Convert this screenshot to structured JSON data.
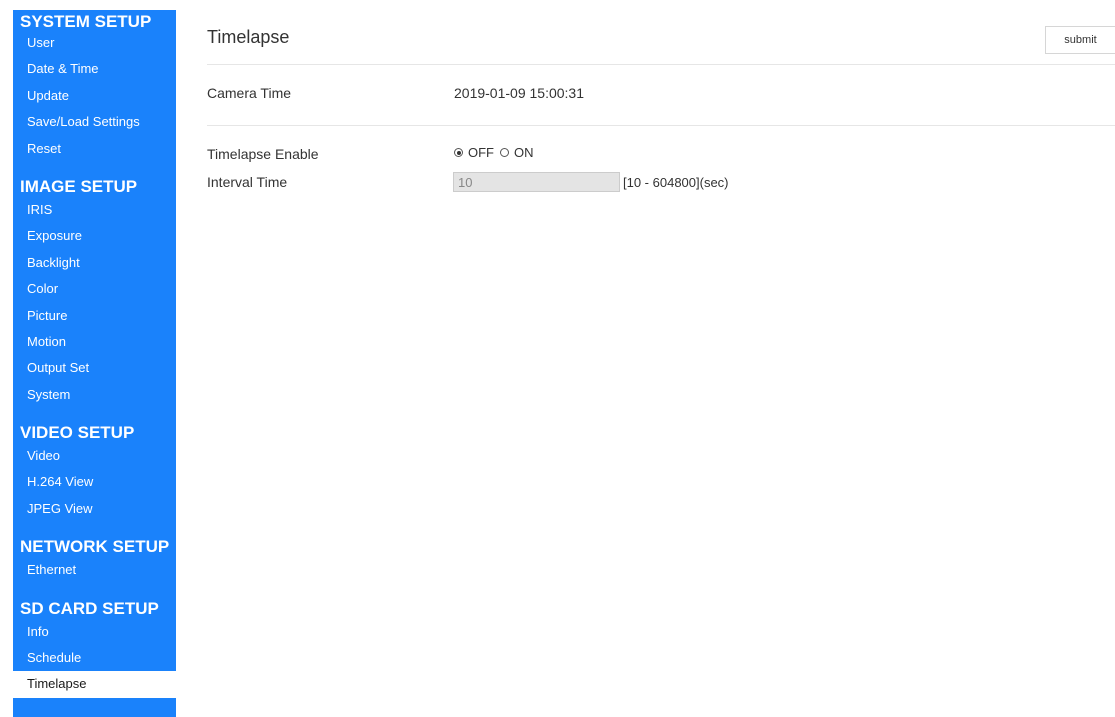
{
  "sidebar": {
    "sections": [
      {
        "title": "SYSTEM SETUP",
        "items": [
          "User",
          "Date & Time",
          "Update",
          "Save/Load Settings",
          "Reset"
        ]
      },
      {
        "title": "IMAGE SETUP",
        "items": [
          "IRIS",
          "Exposure",
          "Backlight",
          "Color",
          "Picture",
          "Motion",
          "Output Set",
          "System"
        ]
      },
      {
        "title": "VIDEO SETUP",
        "items": [
          "Video",
          "H.264 View",
          "JPEG View"
        ]
      },
      {
        "title": "NETWORK SETUP",
        "items": [
          "Ethernet"
        ]
      },
      {
        "title": "SD CARD SETUP",
        "items": [
          "Info",
          "Schedule",
          "Timelapse"
        ]
      }
    ],
    "active_item": "Timelapse",
    "background_color": "#1a82fb"
  },
  "main": {
    "title": "Timelapse",
    "submit_label": "submit",
    "camera_time": {
      "label": "Camera Time",
      "value": "2019-01-09 15:00:31"
    },
    "timelapse_enable": {
      "label": "Timelapse Enable",
      "options": [
        "OFF",
        "ON"
      ],
      "selected": "OFF"
    },
    "interval_time": {
      "label": "Interval Time",
      "value": "10",
      "range": "[10 - 604800](sec)"
    }
  }
}
